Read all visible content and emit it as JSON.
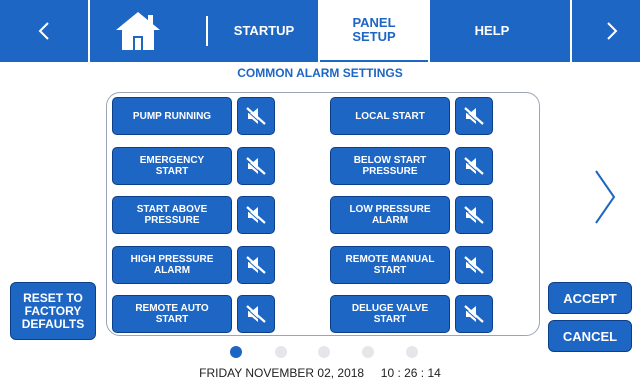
{
  "colors": {
    "primary": "#1e66c4",
    "background": "#ffffff",
    "inactive_dot": "#e4e6ea"
  },
  "header": {
    "prev_icon": "chevron-left-icon",
    "home_icon": "home-icon",
    "next_icon": "chevron-right-icon",
    "tabs": [
      {
        "label": "STARTUP",
        "active": false
      },
      {
        "label": "PANEL\nSETUP",
        "active": true
      },
      {
        "label": "HELP",
        "active": false
      }
    ]
  },
  "section_title": "COMMON ALARM SETTINGS",
  "alarms": {
    "mute_icon": "speaker-muted-icon",
    "left": [
      {
        "label": "PUMP RUNNING"
      },
      {
        "label": "EMERGENCY\nSTART"
      },
      {
        "label": "START ABOVE\nPRESSURE"
      },
      {
        "label": "HIGH PRESSURE\nALARM"
      },
      {
        "label": "REMOTE AUTO\nSTART"
      }
    ],
    "right": [
      {
        "label": "LOCAL START"
      },
      {
        "label": "BELOW START\nPRESSURE"
      },
      {
        "label": "LOW PRESSURE\nALARM"
      },
      {
        "label": "REMOTE MANUAL\nSTART"
      },
      {
        "label": "DELUGE VALVE\nSTART"
      }
    ]
  },
  "next_page_icon": "chevron-right-icon",
  "buttons": {
    "reset": "RESET TO\nFACTORY\nDEFAULTS",
    "accept": "ACCEPT",
    "cancel": "CANCEL"
  },
  "pagination": {
    "pages": 5,
    "current": 1
  },
  "status": {
    "datetime": "FRIDAY NOVEMBER 02, 2018     10 : 26 : 14"
  }
}
